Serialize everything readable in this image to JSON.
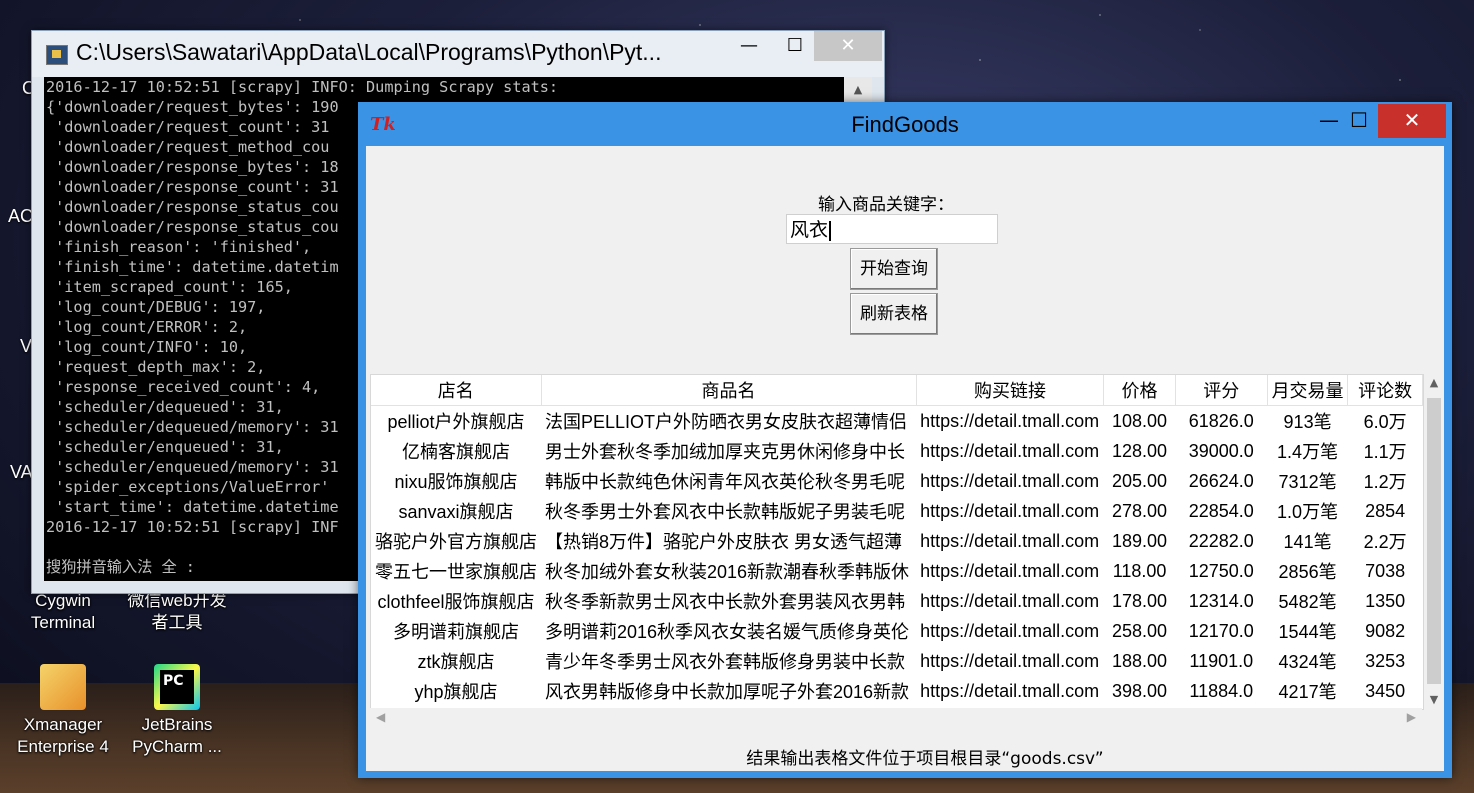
{
  "desktop": {
    "icons": [
      {
        "label_line1": "Cygwin",
        "label_line2": "Terminal"
      },
      {
        "label_line1": "微信web开发",
        "label_line2": "者工具"
      },
      {
        "label_line1": "Xmanager",
        "label_line2": "Enterprise 4"
      },
      {
        "label_line1": "JetBrains",
        "label_line2": "PyCharm ..."
      }
    ],
    "edge_letters": [
      "C",
      "AC",
      "V",
      "VA"
    ]
  },
  "console": {
    "title": "C:\\Users\\Sawatari\\AppData\\Local\\Programs\\Python\\Pyt...",
    "minimize": "—",
    "maximize": "☐",
    "close": "✕",
    "lines": [
      "2016-12-17 10:52:51 [scrapy] INFO: Dumping Scrapy stats:",
      "{'downloader/request_bytes': 190",
      " 'downloader/request_count': 31",
      " 'downloader/request_method_cou",
      " 'downloader/response_bytes': 18",
      " 'downloader/response_count': 31",
      " 'downloader/response_status_cou",
      " 'downloader/response_status_cou",
      " 'finish_reason': 'finished',",
      " 'finish_time': datetime.datetim",
      " 'item_scraped_count': 165,",
      " 'log_count/DEBUG': 197,",
      " 'log_count/ERROR': 2,",
      " 'log_count/INFO': 10,",
      " 'request_depth_max': 2,",
      " 'response_received_count': 4,",
      " 'scheduler/dequeued': 31,",
      " 'scheduler/dequeued/memory': 31",
      " 'scheduler/enqueued': 31,",
      " 'scheduler/enqueued/memory': 31",
      " 'spider_exceptions/ValueError'",
      " 'start_time': datetime.datetime",
      "2016-12-17 10:52:51 [scrapy] INF",
      "",
      "搜狗拼音输入法 全 :"
    ]
  },
  "findgoods": {
    "title": "FindGoods",
    "icon_text": "Tk",
    "minimize": "—",
    "maximize": "☐",
    "close": "✕",
    "keyword_label": "输入商品关键字：",
    "keyword_value": "风衣",
    "search_button": "开始查询",
    "refresh_button": "刷新表格",
    "columns": [
      "店名",
      "商品名",
      "购买链接",
      "价格",
      "评分",
      "月交易量",
      "评论数"
    ],
    "rows": [
      [
        "pelliot户外旗舰店",
        "法国PELLIOT户外防晒衣男女皮肤衣超薄情侣",
        "https://detail.tmall.com",
        "108.00",
        "61826.0",
        "913笔",
        "6.0万"
      ],
      [
        "亿楠客旗舰店",
        "男士外套秋冬季加绒加厚夹克男休闲修身中长",
        "https://detail.tmall.com",
        "128.00",
        "39000.0",
        "1.4万笔",
        "1.1万"
      ],
      [
        "nixu服饰旗舰店",
        "韩版中长款纯色休闲青年风衣英伦秋冬男毛呢",
        "https://detail.tmall.com",
        "205.00",
        "26624.0",
        "7312笔",
        "1.2万"
      ],
      [
        "sanvaxi旗舰店",
        "秋冬季男士外套风衣中长款韩版妮子男装毛呢",
        "https://detail.tmall.com",
        "278.00",
        "22854.0",
        "1.0万笔",
        "2854"
      ],
      [
        "骆驼户外官方旗舰店",
        "【热销8万件】骆驼户外皮肤衣 男女透气超薄",
        "https://detail.tmall.com",
        "189.00",
        "22282.0",
        "141笔",
        "2.2万"
      ],
      [
        "零五七一世家旗舰店",
        "秋冬加绒外套女秋装2016新款潮春秋季韩版休",
        "https://detail.tmall.com",
        "118.00",
        "12750.0",
        "2856笔",
        "7038"
      ],
      [
        "clothfeel服饰旗舰店",
        "秋冬季新款男士风衣中长款外套男装风衣男韩",
        "https://detail.tmall.com",
        "178.00",
        "12314.0",
        "5482笔",
        "1350"
      ],
      [
        "多明谱莉旗舰店",
        "多明谱莉2016秋季风衣女装名媛气质修身英伦",
        "https://detail.tmall.com",
        "258.00",
        "12170.0",
        "1544笔",
        "9082"
      ],
      [
        "ztk旗舰店",
        "青少年冬季男士风衣外套韩版修身男装中长款",
        "https://detail.tmall.com",
        "188.00",
        "11901.0",
        "4324笔",
        "3253"
      ],
      [
        "yhp旗舰店",
        "风衣男韩版修身中长款加厚呢子外套2016新款",
        "https://detail.tmall.com",
        "398.00",
        "11884.0",
        "4217笔",
        "3450"
      ]
    ],
    "footer_note": "结果输出表格文件位于项目根目录“goods.csv”"
  }
}
